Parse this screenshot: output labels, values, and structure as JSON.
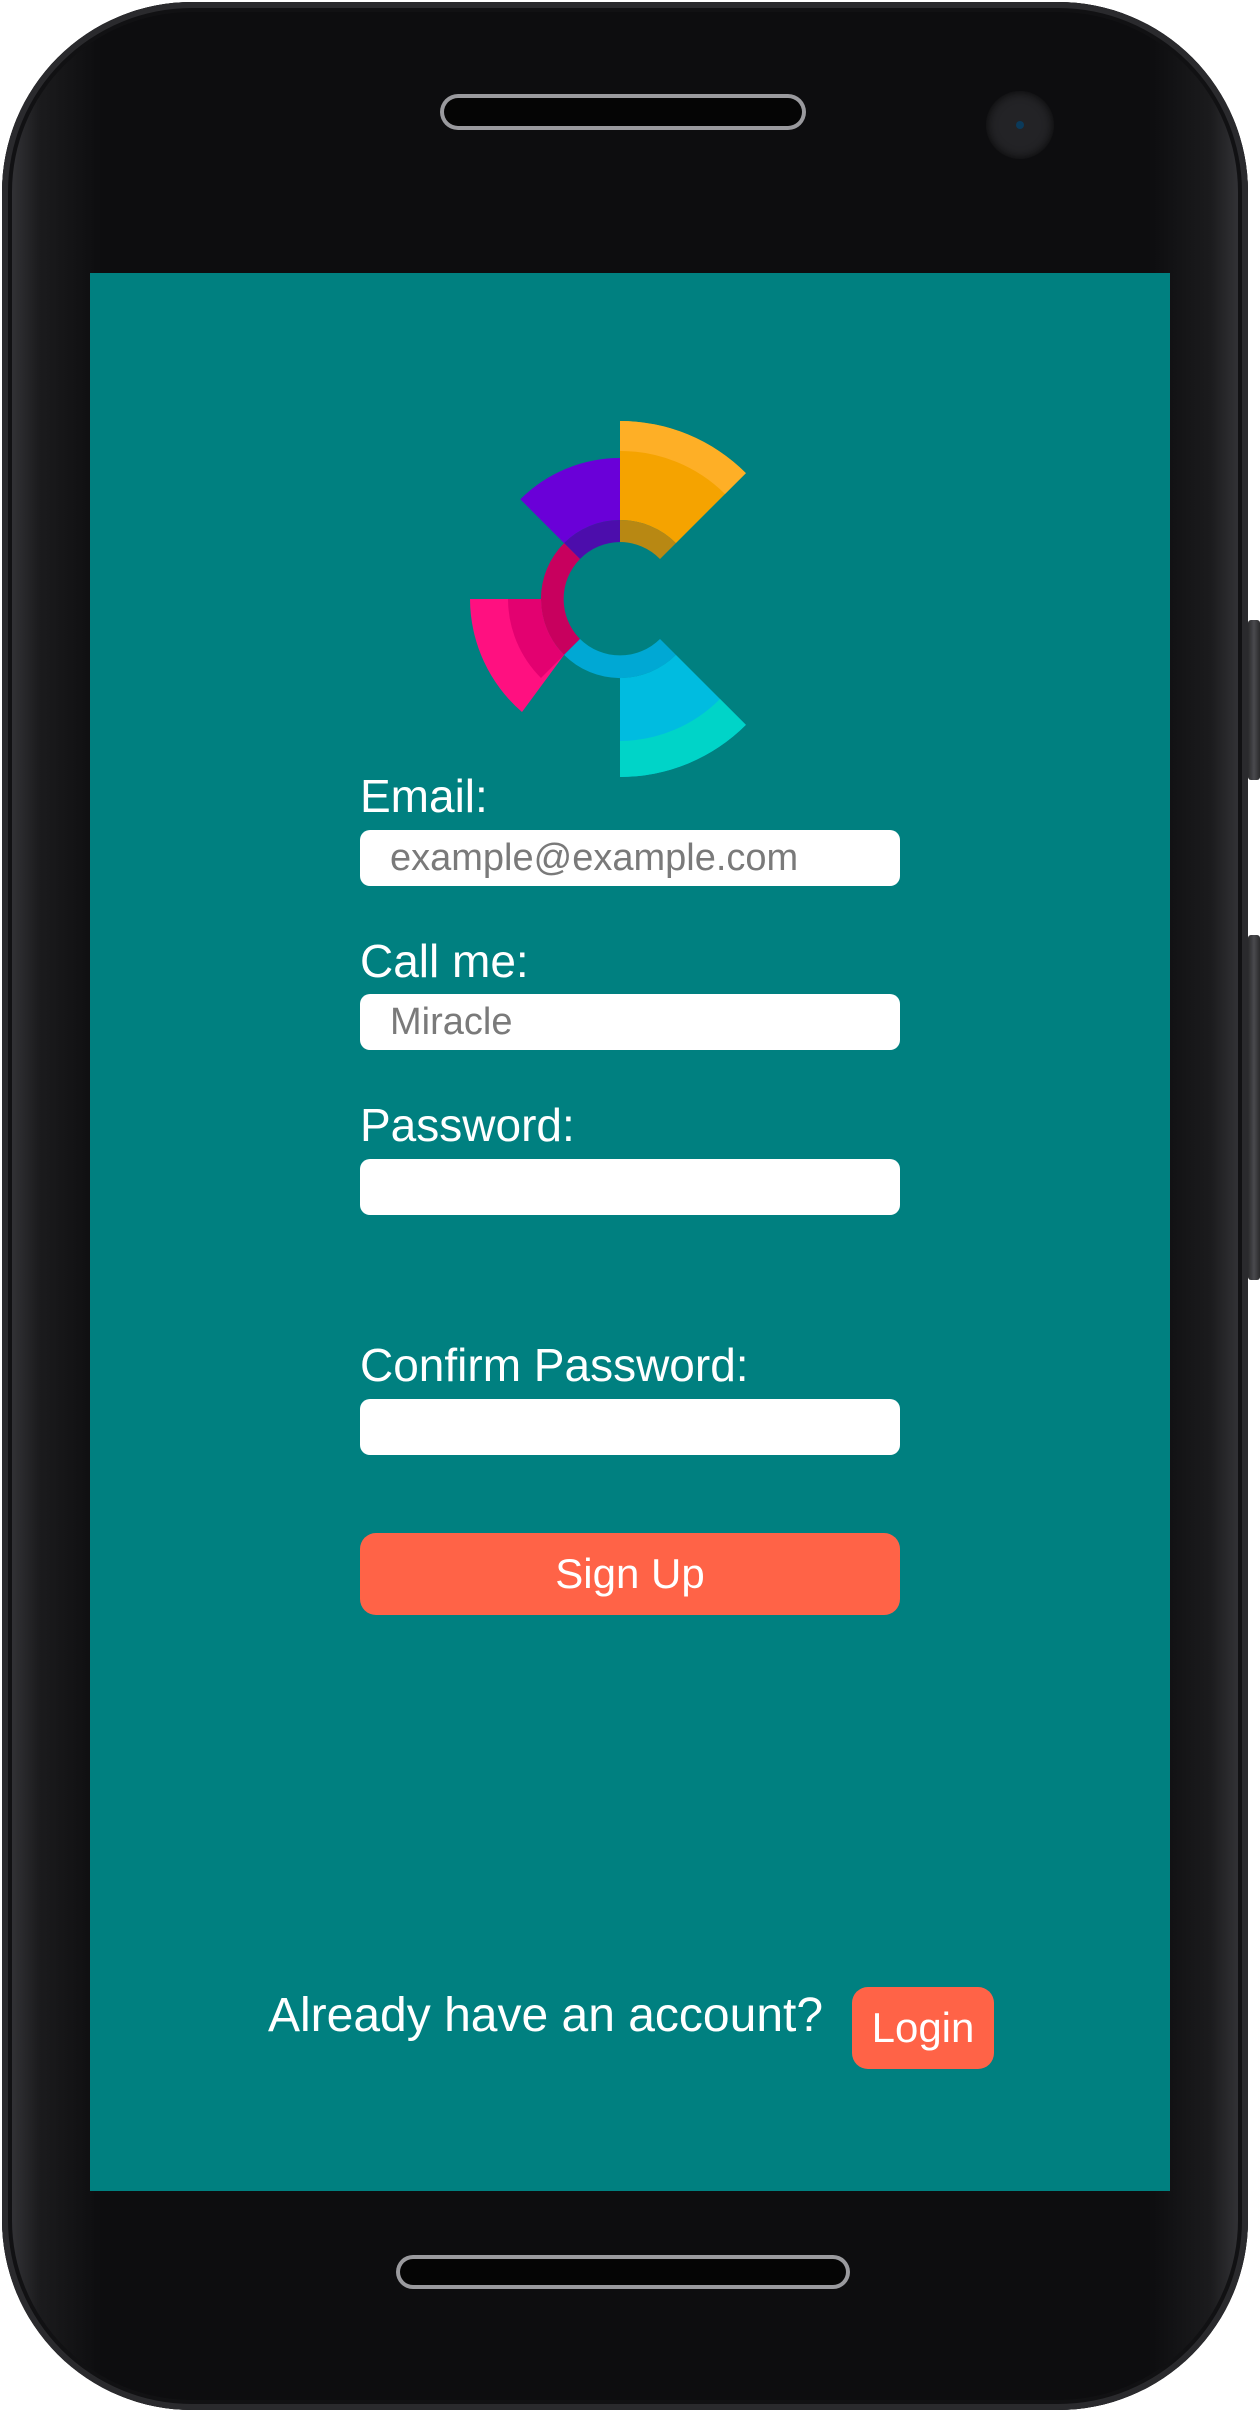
{
  "theme": {
    "screen_background": "#008080",
    "accent": "#FF6347",
    "text": "#FFFFFF"
  },
  "logo": {
    "icon": "logo-icon",
    "colors": [
      "#F5A300",
      "#6A00D8",
      "#E0006E",
      "#00B4D8",
      "#00D0C8"
    ]
  },
  "form": {
    "email": {
      "label": "Email:",
      "placeholder": "example@example.com",
      "value": ""
    },
    "callme": {
      "label": "Call me:",
      "placeholder": "Miracle",
      "value": ""
    },
    "password": {
      "label": "Password:",
      "placeholder": "",
      "value": ""
    },
    "confirm": {
      "label": "Confirm Password:",
      "placeholder": "",
      "value": ""
    },
    "submit_label": "Sign Up"
  },
  "footer": {
    "prompt": "Already have an account?",
    "login_label": "Login"
  }
}
